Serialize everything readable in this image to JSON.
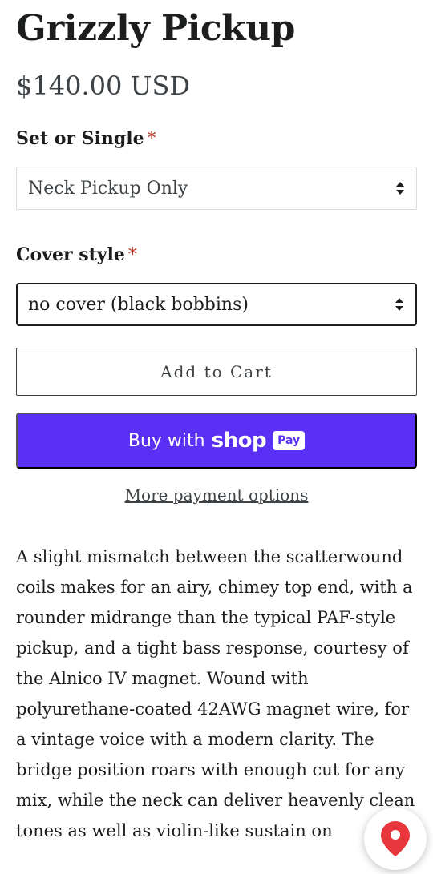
{
  "product": {
    "title": "Grizzly Pickup",
    "price": "$140.00 USD"
  },
  "options": {
    "set_or_single": {
      "label": "Set or Single",
      "required_mark": "*",
      "selected": "Neck Pickup Only"
    },
    "cover_style": {
      "label": "Cover style",
      "required_mark": "*",
      "selected": "no cover (black bobbins)"
    }
  },
  "actions": {
    "add_to_cart": "Add to Cart",
    "buy_with": "Buy with",
    "shop_word": "shop",
    "pay_badge": "Pay",
    "more_payment": "More payment options"
  },
  "description": "A slight mismatch between the scatterwound coils makes for an airy, chimey top end, with a rounder midrange than the typical PAF-style pickup, and a tight bass response, courtesy of the Alnico IV magnet. Wound with polyurethane-coated 42AWG magnet wire, for a vintage voice with a modern clarity. The bridge position roars with enough cut for any mix, while the neck can deliver heavenly clean tones as well as violin-like sustain on",
  "colors": {
    "shop_pay_purple": "#5a31f4",
    "required_red": "#c0392b",
    "location_pin_red": "#e8363c"
  },
  "icons": {
    "select_arrows": "select-arrows-icon",
    "location": "location-pin-icon"
  }
}
